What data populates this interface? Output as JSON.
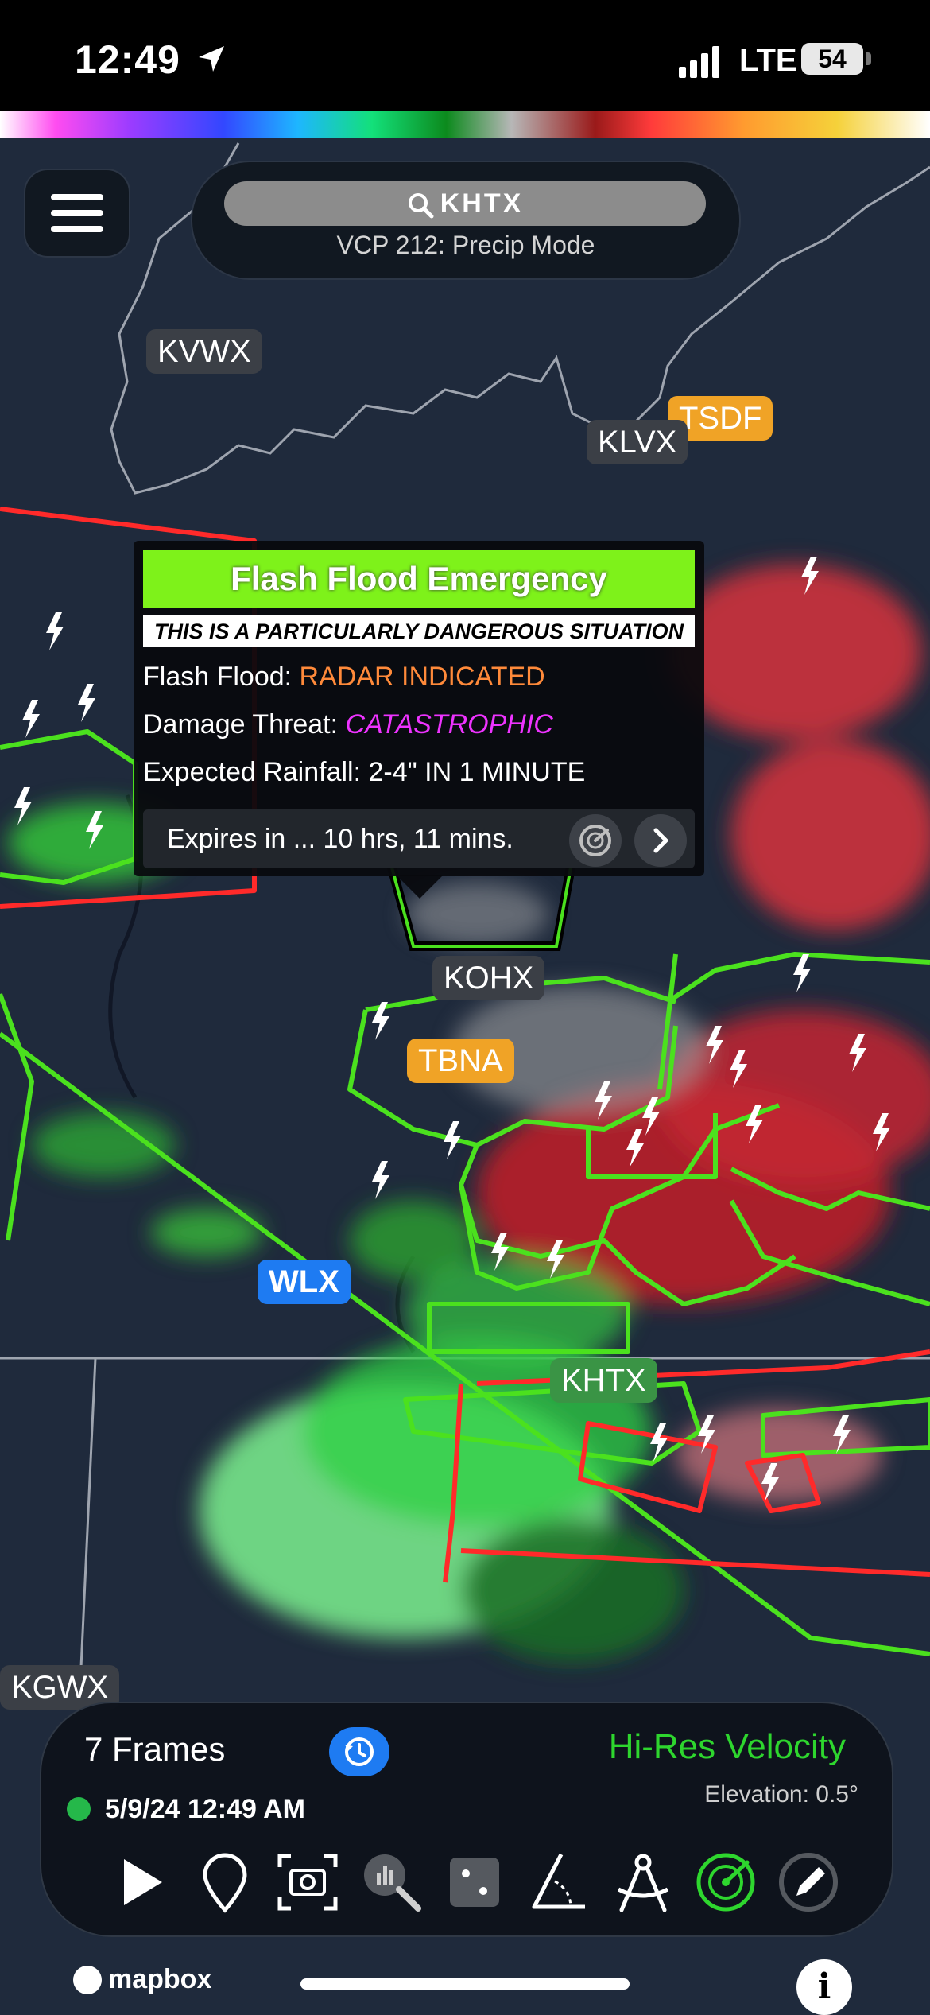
{
  "status_bar": {
    "time": "12:49",
    "network": "LTE",
    "battery": "54"
  },
  "colors": {
    "alert_green": "#7ef21a",
    "velocity_green": "#2ed62e",
    "velocity_red": "#d8323c",
    "warning_outline": "#4be11e",
    "polygon_red": "#ff2a2a",
    "accent_blue": "#1e7bf2"
  },
  "search": {
    "value": "KHTX",
    "scan_mode": "VCP 212: Precip Mode"
  },
  "map": {
    "sites": {
      "kvwx": "KVWX",
      "klvx": "KLVX",
      "tsdf": "TSDF",
      "kohx": "KOHX",
      "tbna": "TBNA",
      "wlx": "WLX",
      "khtx": "KHTX",
      "kgwx": "KGWX"
    }
  },
  "alert": {
    "title": "Flash Flood Emergency",
    "banner": "THIS IS A PARTICULARLY DANGEROUS SITUATION",
    "flash_flood_label": "Flash Flood: ",
    "flash_flood_value": "RADAR INDICATED",
    "damage_label": "Damage Threat: ",
    "damage_value": "CATASTROPHIC",
    "rainfall": "Expected Rainfall: 2-4\" IN 1 MINUTE",
    "expires": "Expires in ... 10 hrs, 11 mins."
  },
  "playback": {
    "frames": "7 Frames",
    "product": "Hi-Res Velocity",
    "elevation": "Elevation: 0.5°",
    "timestamp": "5/9/24 12:49 AM"
  },
  "toolbar": {
    "icons": [
      "play-icon",
      "location-pin-icon",
      "screenshot-camera-icon",
      "inspect-magnifier-icon",
      "dice-icon",
      "angle-measure-icon",
      "compass-tool-icon",
      "radar-icon",
      "draw-pencil-icon"
    ]
  },
  "footer": {
    "logo": "mapbox",
    "info": "i"
  }
}
